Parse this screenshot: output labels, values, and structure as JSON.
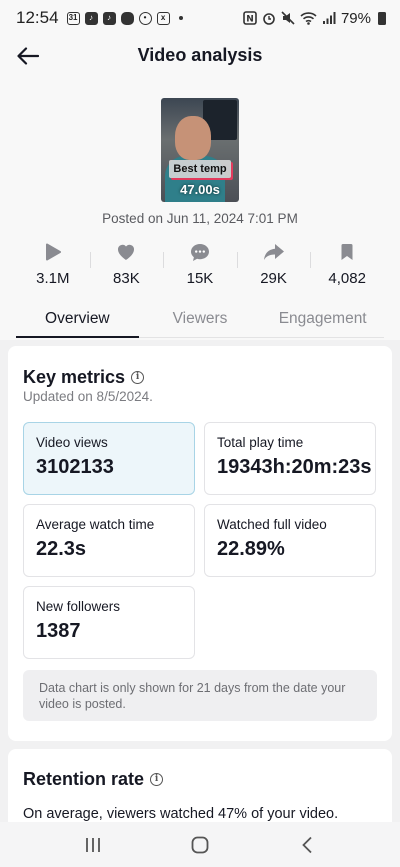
{
  "status_bar": {
    "time": "12:54",
    "left_icons": [
      "calendar-icon",
      "tiktok-icon",
      "tiktok-icon",
      "app-icon",
      "settings-icon",
      "app-icon"
    ],
    "calendar_day": "31",
    "battery": "79%"
  },
  "header": {
    "title": "Video analysis",
    "back_icon": "arrow-left-icon"
  },
  "video": {
    "thumbnail_caption": "Best temp",
    "duration": "47.00s",
    "posted": "Posted on Jun 11, 2024 7:01 PM"
  },
  "stats": [
    {
      "icon": "play-icon",
      "value": "3.1M"
    },
    {
      "icon": "heart-icon",
      "value": "83K"
    },
    {
      "icon": "comment-icon",
      "value": "15K"
    },
    {
      "icon": "share-icon",
      "value": "29K"
    },
    {
      "icon": "bookmark-icon",
      "value": "4,082"
    }
  ],
  "tabs": [
    {
      "label": "Overview",
      "active": true
    },
    {
      "label": "Viewers",
      "active": false
    },
    {
      "label": "Engagement",
      "active": false
    }
  ],
  "key_metrics": {
    "title": "Key metrics",
    "updated": "Updated on 8/5/2024.",
    "metrics": [
      {
        "label": "Video views",
        "value": "3102133",
        "selected": true
      },
      {
        "label": "Total play time",
        "value": "19343h:20m:23s",
        "selected": false
      },
      {
        "label": "Average watch time",
        "value": "22.3s",
        "selected": false
      },
      {
        "label": "Watched full video",
        "value": "22.89%",
        "selected": false
      },
      {
        "label": "New followers",
        "value": "1387",
        "selected": false
      }
    ],
    "note": "Data chart is only shown for 21 days from the date your video is posted."
  },
  "retention": {
    "title": "Retention rate",
    "description": "On average, viewers watched 47% of your video."
  },
  "nav": [
    "recent-apps-icon",
    "home-icon",
    "back-icon"
  ],
  "colors": {
    "selected_card_bg": "#edf6fa",
    "selected_card_border": "#a8d4e6",
    "text_primary": "#161823",
    "text_secondary": "#8a8b91"
  }
}
